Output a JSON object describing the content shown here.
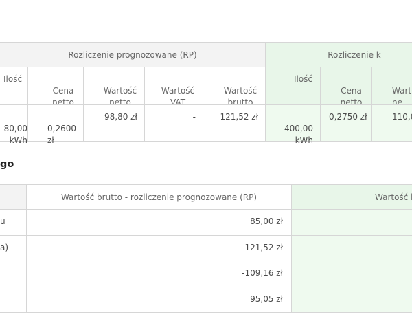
{
  "table1": {
    "group_rp": "Rozliczenie prognozowane (RP)",
    "group_k": "Rozliczenie k",
    "columns": [
      "Ilość",
      "Cena\nnetto",
      "Wartość\nnetto",
      "Wartość\nVAT",
      "Wartość\nbrutto",
      "Ilość",
      "Cena\nnetto",
      "Wart\nne"
    ],
    "row": [
      "80,00\nkWh",
      "0,2600\nzł",
      "98,80 zł",
      "-",
      "121,52 zł",
      "400,00\nkWh",
      "0,2750 zł",
      "110,0"
    ]
  },
  "section_title": "go",
  "table2": {
    "header_rp": "Wartość brutto - rozliczenie prognozowane (RP)",
    "header_k": "Wartość b",
    "rows": [
      {
        "label": "u",
        "value": "85,00 zł"
      },
      {
        "label": "a)",
        "value": "121,52 zł"
      },
      {
        "label": "",
        "value": "-109,16 zł"
      },
      {
        "label": "",
        "value": "95,05 zł"
      }
    ]
  }
}
